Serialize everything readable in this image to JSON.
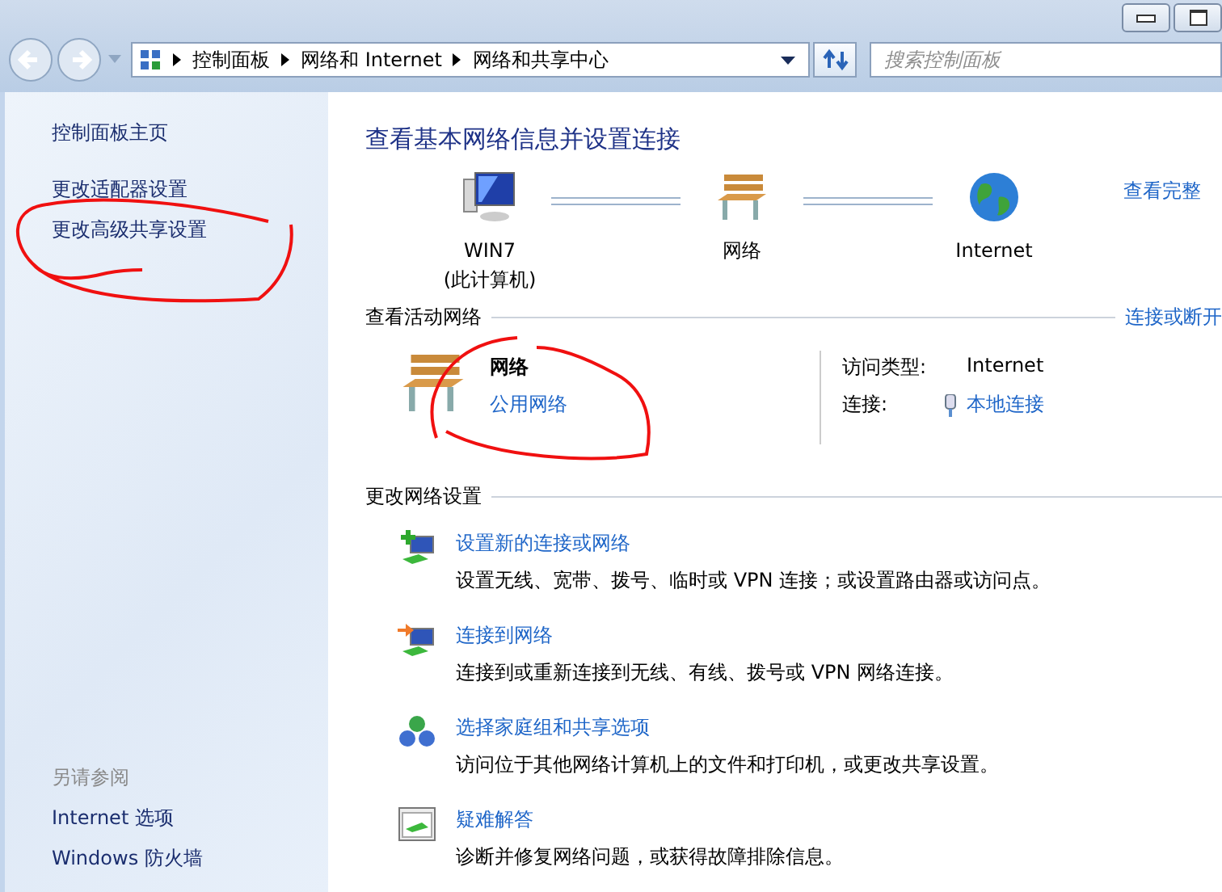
{
  "address_bar": {
    "breadcrumb": [
      "控制面板",
      "网络和 Internet",
      "网络和共享中心"
    ]
  },
  "search": {
    "placeholder": "搜索控制面板"
  },
  "sidebar": {
    "home": "控制面板主页",
    "links": [
      "更改适配器设置",
      "更改高级共享设置"
    ],
    "see_also_heading": "另请参阅",
    "see_also": [
      "Internet 选项",
      "Windows 防火墙"
    ]
  },
  "main": {
    "title": "查看基本网络信息并设置连接",
    "map": {
      "nodes": [
        {
          "kind": "computer",
          "lines": [
            "WIN7",
            "(此计算机)"
          ]
        },
        {
          "kind": "network",
          "lines": [
            "网络"
          ]
        },
        {
          "kind": "internet",
          "lines": [
            "Internet"
          ]
        }
      ],
      "link": "查看完整"
    },
    "active_networks": {
      "heading": "查看活动网络",
      "link": "连接或断开",
      "name": "网络",
      "type": "公用网络",
      "access_type_label": "访问类型:",
      "access_type": "Internet",
      "connections_label": "连接:",
      "connection": "本地连接"
    },
    "change_settings": {
      "heading": "更改网络设置",
      "tasks": [
        {
          "kind": "new-connection",
          "title": "设置新的连接或网络",
          "description": "设置无线、宽带、拨号、临时或 VPN 连接；或设置路由器或访问点。"
        },
        {
          "kind": "connect",
          "title": "连接到网络",
          "description": "连接到或重新连接到无线、有线、拨号或 VPN 网络连接。"
        },
        {
          "kind": "homegroup",
          "title": "选择家庭组和共享选项",
          "description": "访问位于其他网络计算机上的文件和打印机，或更改共享设置。"
        },
        {
          "kind": "troubleshoot",
          "title": "疑难解答",
          "description": "诊断并修复网络问题，或获得故障排除信息。"
        }
      ]
    }
  }
}
